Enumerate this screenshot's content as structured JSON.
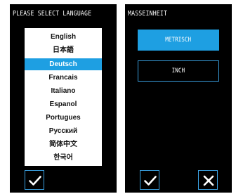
{
  "language_panel": {
    "title": "PLEASE SELECT LANGUAGE",
    "languages": [
      "English",
      "日本語",
      "Deutsch",
      "Francais",
      "Italiano",
      "Espanol",
      "Portugues",
      "Русский",
      "简体中文",
      "한국어"
    ],
    "selected": "Deutsch",
    "confirm_icon": "checkmark-icon"
  },
  "unit_panel": {
    "title": "MASSEINHEIT",
    "options": [
      "METRISCH",
      "INCH"
    ],
    "selected": "METRISCH",
    "confirm_icon": "checkmark-icon",
    "cancel_icon": "close-icon"
  },
  "colors": {
    "panel_bg": "#000000",
    "accent": "#1e9fe2",
    "list_bg": "#ffffff"
  }
}
